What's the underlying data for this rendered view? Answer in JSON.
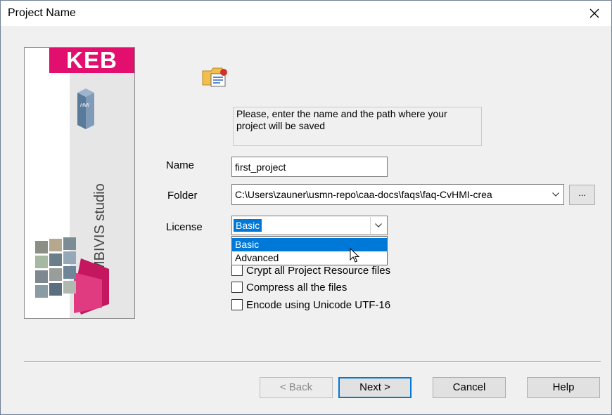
{
  "window": {
    "title": "Project Name"
  },
  "banner": {
    "brand": "KEB",
    "product": "COMBIVIS studio",
    "hmi_badge": "HMI"
  },
  "info_text": "Please, enter the name and the path where your project will be saved",
  "form": {
    "name_label": "Name",
    "name_value": "first_project",
    "folder_label": "Folder",
    "folder_value": "C:\\Users\\zauner\\usmn-repo\\caa-docs\\faqs\\faq-CvHMI-crea",
    "browse_label": "...",
    "license_label": "License",
    "license_value": "Basic",
    "license_options": [
      "Basic",
      "Advanced"
    ]
  },
  "options": [
    {
      "label": "Crypt all Project Resource files",
      "checked": false
    },
    {
      "label": "Compress all the files",
      "checked": false
    },
    {
      "label": "Encode using Unicode UTF-16",
      "checked": false
    }
  ],
  "buttons": {
    "back": "< Back",
    "next": "Next >",
    "cancel": "Cancel",
    "help": "Help"
  },
  "colors": {
    "accent": "#0078d7",
    "brand": "#e30f6f"
  }
}
